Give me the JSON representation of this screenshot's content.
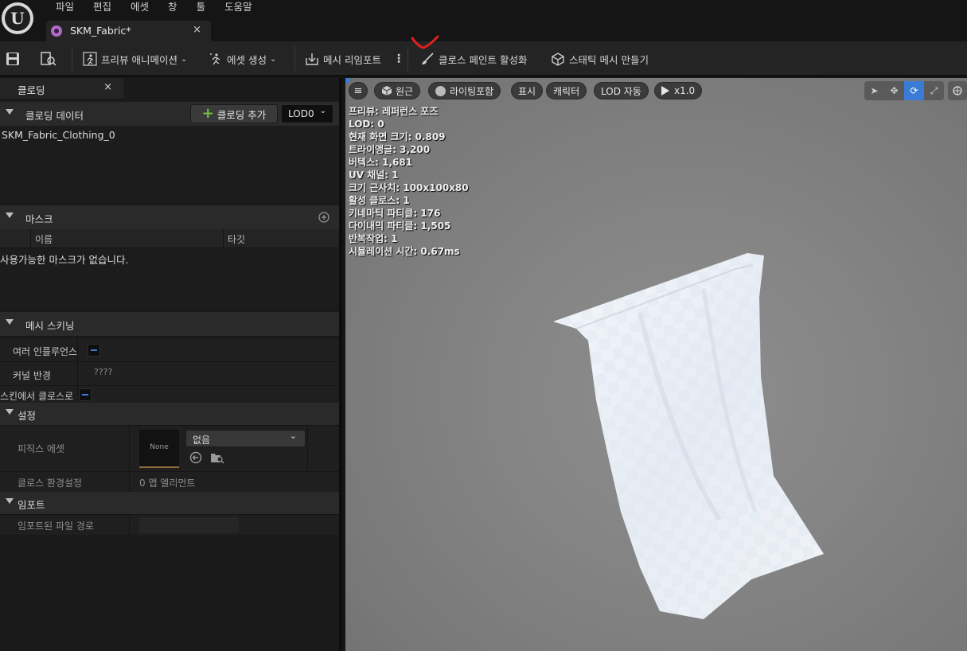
{
  "menu": [
    "파일",
    "편집",
    "에셋",
    "창",
    "툴",
    "도움말"
  ],
  "document_tab": {
    "label": "SKM_Fabric*",
    "close": "×"
  },
  "toolbar": {
    "preview_anim": "프리뷰 애니메이션",
    "asset_create": "에셋 생성",
    "mesh_reimport": "메시 리임포트",
    "cloth_paint": "클로스 페인트 활성화",
    "make_static_mesh": "스태틱 메시 만들기",
    "more": "⋮"
  },
  "left_panel": {
    "tab_label": "클로딩",
    "tab_close": "×",
    "cloth_data": {
      "title": "클로딩 데이터",
      "add_button": "클로딩 추가",
      "lod_select": "LOD0",
      "items": [
        "SKM_Fabric_Clothing_0"
      ]
    },
    "masks": {
      "title": "마스크",
      "col_name": "이름",
      "col_target": "타깃",
      "empty_text": "사용가능한 마스크가 없습니다."
    },
    "mesh_skinning": {
      "title": "메시 스키닝",
      "rows": [
        {
          "label": "여러 인플루언스 사",
          "value": ""
        },
        {
          "label": "커널 반경",
          "value": "????"
        },
        {
          "label": "스킨에서 클로스로 부",
          "value": ""
        }
      ]
    },
    "settings": {
      "title": "설정",
      "physics_asset_label": "피직스 에셋",
      "thumbnail_text": "None",
      "physics_asset_value": "없음",
      "cloth_config_label": "클로스 환경설정",
      "cloth_config_value": "0 맵 엘리먼트"
    },
    "import": {
      "title": "임포트",
      "path_label": "임포트된 파일 경로",
      "path_value": ""
    }
  },
  "viewport": {
    "buttons": {
      "perspective": "원근",
      "lighting": "라이팅포함",
      "show": "표시",
      "character": "캐릭터",
      "lod": "LOD 자동",
      "play": "x1.0"
    },
    "stats": [
      "프리뷰: 레퍼런스 포즈",
      "LOD: 0",
      "현재 화면 크기: 0.809",
      "트라이앵글: 3,200",
      "버텍스: 1,681",
      "UV 채널: 1",
      "크기 근사치: 100x100x80",
      "활성 클로스: 1",
      "키네마틱 파티클: 176",
      "다이내믹 파티클: 1,505",
      "반복작업: 1",
      "시뮬레이션 시간: 0.67ms"
    ]
  },
  "colors": {
    "accent": "#3a7bd5",
    "add_icon": "#7ac043",
    "annotation": "#e02020"
  }
}
